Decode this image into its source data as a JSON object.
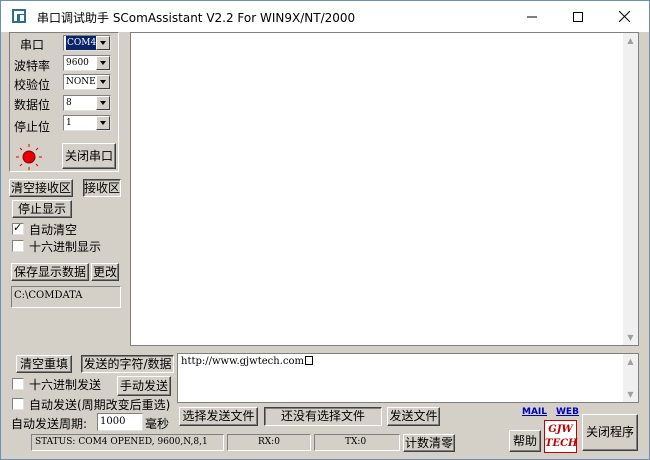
{
  "window": {
    "title": "串口调试助手 SComAssistant V2.2 For WIN9X/NT/2000"
  },
  "settings": {
    "port": {
      "label": "串口",
      "value": "COM4"
    },
    "baud": {
      "label": "波特率",
      "value": "9600"
    },
    "parity": {
      "label": "校验位",
      "value": "NONE"
    },
    "databits": {
      "label": "数据位",
      "value": "8"
    },
    "stopbits": {
      "label": "停止位",
      "value": "1"
    },
    "close_port_label": "关闭串口",
    "led_color": "#e60000"
  },
  "receive": {
    "clear_label": "清空接收区",
    "area_label": "接收区",
    "stop_display_label": "停止显示",
    "auto_clear_label": "自动清空",
    "auto_clear_checked": true,
    "hex_display_label": "十六进制显示",
    "hex_display_checked": false,
    "save_label": "保存显示数据",
    "change_label": "更改",
    "save_path": "C:\\COMDATA",
    "content": ""
  },
  "send": {
    "clear_label": "清空重填",
    "chars_label": "发送的字符/数据",
    "hex_send_label": "十六进制发送",
    "hex_send_checked": false,
    "manual_send_label": "手动发送",
    "auto_send_label": "自动发送(周期改变后重选)",
    "auto_send_checked": false,
    "period_label": "自动发送周期:",
    "period_value": "1000",
    "period_unit": "毫秒",
    "select_file_label": "选择发送文件",
    "file_status": "还没有选择文件",
    "send_file_label": "发送文件",
    "text": "http://www.gjwtech.com"
  },
  "footer": {
    "mail_label": "MAIL",
    "web_label": "WEB",
    "help_label": "帮助",
    "logo_line1": "GJW",
    "logo_line2": "TECH",
    "close_program_label": "关闭程序",
    "status": "STATUS: COM4 OPENED, 9600,N,8,1",
    "rx": "RX:0",
    "tx": "TX:0",
    "reset_count_label": "计数清零"
  }
}
